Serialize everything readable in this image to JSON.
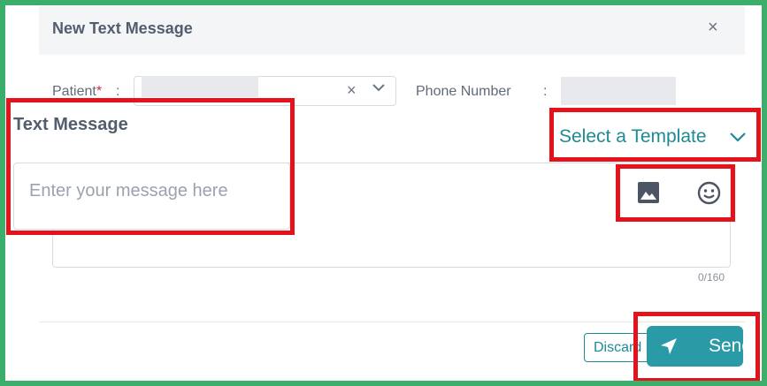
{
  "modal": {
    "title": "New Text Message",
    "close_symbol": "×"
  },
  "patient": {
    "label": "Patient",
    "required_mark": "*",
    "separator": ":",
    "clear_symbol": "×"
  },
  "phone": {
    "label": "Phone Number",
    "separator": ":"
  },
  "message": {
    "section_title": "Text Message",
    "template_label": "Select a Template",
    "placeholder": "Enter your message here",
    "counter": "0/160"
  },
  "actions": {
    "discard_label": "Discard",
    "send_label": "Send"
  },
  "icons": [
    "close-icon",
    "chevron-down-icon",
    "image-icon",
    "emoji-icon",
    "send-icon"
  ],
  "colors": {
    "accent": "#1e8a95",
    "send_button": "#2a9aa6",
    "title_text": "#525e6e",
    "required": "#d9263f",
    "highlight_box": "#e3121b",
    "outer_frame": "#3aae6a"
  }
}
